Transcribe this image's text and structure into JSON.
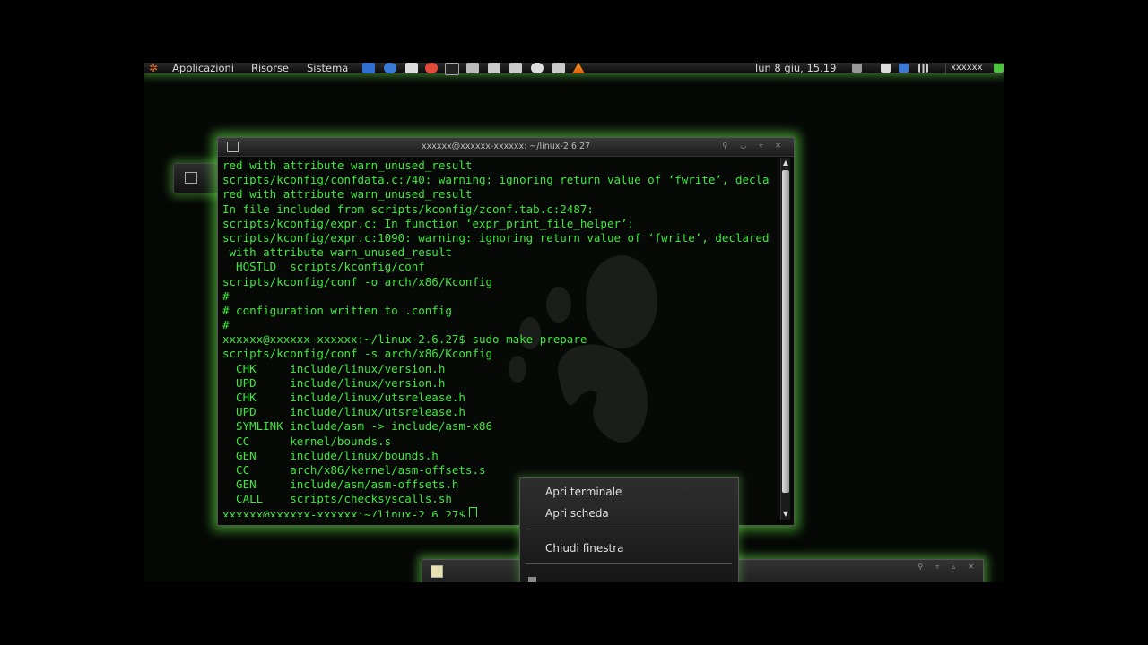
{
  "panel": {
    "menus": [
      "Applicazioni",
      "Risorse",
      "Sistema"
    ],
    "clock": "lun  8 giu, 15.19",
    "user": "xxxxxx"
  },
  "terminal": {
    "title": "xxxxxx@xxxxxx-xxxxxx: ~/linux-2.6.27",
    "lines": [
      "red with attribute warn_unused_result",
      "scripts/kconfig/confdata.c:740: warning: ignoring return value of ‘fwrite’, decla",
      "red with attribute warn_unused_result",
      "In file included from scripts/kconfig/zconf.tab.c:2487:",
      "scripts/kconfig/expr.c: In function ‘expr_print_file_helper’:",
      "scripts/kconfig/expr.c:1090: warning: ignoring return value of ‘fwrite’, declared",
      " with attribute warn_unused_result",
      "  HOSTLD  scripts/kconfig/conf",
      "scripts/kconfig/conf -o arch/x86/Kconfig",
      "#",
      "# configuration written to .config",
      "#",
      "xxxxxx@xxxxxx-xxxxxx:~/linux-2.6.27$ sudo make prepare",
      "scripts/kconfig/conf -s arch/x86/Kconfig",
      "  CHK     include/linux/version.h",
      "  UPD     include/linux/version.h",
      "  CHK     include/linux/utsrelease.h",
      "  UPD     include/linux/utsrelease.h",
      "  SYMLINK include/asm -> include/asm-x86",
      "  CC      kernel/bounds.s",
      "  GEN     include/linux/bounds.h",
      "  CC      arch/x86/kernel/asm-offsets.s",
      "  GEN     include/asm/asm-offsets.h",
      "  CALL    scripts/checksyscalls.sh"
    ],
    "prompt": "xxxxxx@xxxxxx-xxxxxx:~/linux-2.6.27$"
  },
  "context_menu": {
    "items": [
      "Apri terminale",
      "Apri scheda",
      "Chiudi finestra"
    ]
  },
  "colors": {
    "terminal_text": "#3ee83c",
    "glow": "#78ff5a"
  }
}
